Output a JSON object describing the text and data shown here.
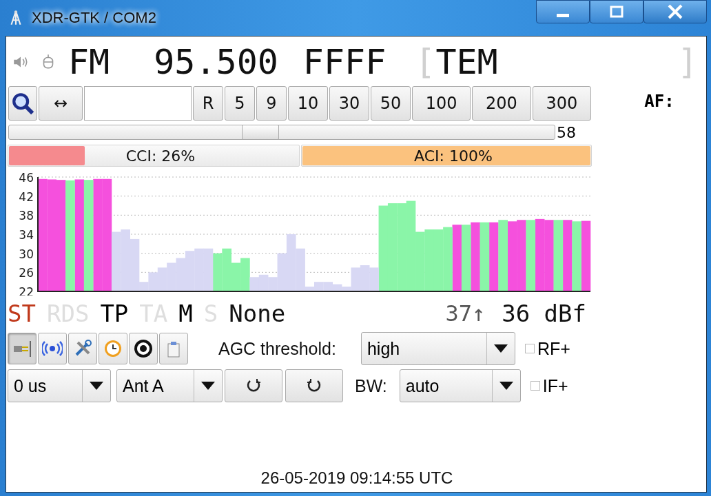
{
  "window": {
    "title": "XDR-GTK / COM2"
  },
  "display": {
    "mode": "FM",
    "frequency": "95.500",
    "pi": "FFFF",
    "ps_open": "[",
    "ps": "TEM",
    "ps_close": "]"
  },
  "toolbar": {
    "step_buttons": [
      "R",
      "5",
      "9",
      "10",
      "30",
      "50",
      "100",
      "200",
      "300"
    ],
    "swap_label": "↔"
  },
  "tuning": {
    "level": 0.46,
    "reading": "58"
  },
  "interference": [
    {
      "label": "CCI: 26%",
      "level": 0.26,
      "color": "#f58a8e"
    },
    {
      "label": "ACI: 100%",
      "level": 1.0,
      "color": "#fbc27e"
    }
  ],
  "af": {
    "label": "AF:"
  },
  "scan": {
    "chart_data": {
      "type": "bar",
      "grid": true,
      "ylim": [
        22,
        46
      ],
      "yticks": [
        22,
        26,
        30,
        34,
        38,
        42,
        46
      ],
      "series": [
        {
          "color": "#f550dd",
          "values": [
            45.6,
            45.5,
            45.4,
            null,
            45.5,
            null,
            45.6,
            45.6,
            null,
            null,
            null,
            null,
            null,
            null,
            null,
            null,
            null,
            null,
            null,
            null,
            null,
            null,
            null,
            null,
            null,
            null,
            null,
            null,
            null,
            null,
            null,
            null,
            null,
            null,
            null,
            null,
            null,
            null,
            null,
            null,
            null,
            null,
            null,
            null,
            null,
            36,
            null,
            36.5,
            null,
            36.5,
            null,
            36.7,
            37,
            null,
            37.2,
            37,
            null,
            37,
            null,
            36.8
          ]
        },
        {
          "color": "#8af5a8",
          "values": [
            null,
            null,
            null,
            45.3,
            null,
            45.4,
            null,
            null,
            null,
            null,
            null,
            null,
            null,
            null,
            null,
            null,
            null,
            null,
            null,
            30,
            31,
            28,
            29,
            null,
            null,
            null,
            null,
            null,
            null,
            null,
            null,
            null,
            null,
            null,
            null,
            null,
            null,
            40,
            40.5,
            40.5,
            41,
            34.5,
            35,
            35,
            35.5,
            null,
            36,
            null,
            36.5,
            null,
            37,
            null,
            null,
            37,
            null,
            null,
            37,
            null,
            36.7,
            null
          ]
        },
        {
          "color": "#d8d8f4",
          "values": [
            null,
            null,
            null,
            null,
            null,
            null,
            null,
            null,
            34.5,
            35,
            33,
            24,
            26,
            27,
            28,
            29,
            30.5,
            31,
            31,
            null,
            null,
            null,
            null,
            25,
            25.5,
            25,
            30,
            34,
            31,
            23,
            24,
            24,
            23.5,
            23,
            27,
            27.5,
            27,
            null,
            null,
            null,
            null,
            null,
            null,
            null,
            null,
            null,
            null,
            null,
            null,
            null,
            null,
            null,
            null,
            null,
            null,
            null,
            null,
            null,
            null,
            null
          ]
        }
      ]
    }
  },
  "flags": [
    {
      "label": "ST",
      "on": true,
      "kind": "stereo"
    },
    {
      "label": "RDS",
      "on": false,
      "kind": "flag"
    },
    {
      "label": "TP",
      "on": true,
      "kind": "flag"
    },
    {
      "label": "TA",
      "on": false,
      "kind": "flag"
    },
    {
      "label": "M",
      "on": true,
      "kind": "flag"
    },
    {
      "label": "S",
      "on": false,
      "kind": "flag"
    }
  ],
  "pty": "None",
  "signal": {
    "peak": "37↑",
    "value": "36 dBf"
  },
  "tools": [
    {
      "kind": "plug",
      "on": true
    },
    {
      "kind": "waves",
      "on": false
    },
    {
      "kind": "tools",
      "on": false
    },
    {
      "kind": "clock",
      "on": false
    },
    {
      "kind": "disc",
      "on": false
    },
    {
      "kind": "clipboard",
      "on": false
    }
  ],
  "agc": {
    "label": "AGC threshold:",
    "value": "high"
  },
  "rf_plus": {
    "label": "RF+",
    "checked": false
  },
  "deemphasis": {
    "value": "0 us"
  },
  "antenna": {
    "value": "Ant A"
  },
  "rotators": [
    {
      "kind": "ccw"
    },
    {
      "kind": "cw"
    }
  ],
  "bandwidth": {
    "label": "BW:",
    "value": "auto"
  },
  "if_plus": {
    "label": "IF+",
    "checked": false
  },
  "status": "26-05-2019 09:14:55 UTC"
}
